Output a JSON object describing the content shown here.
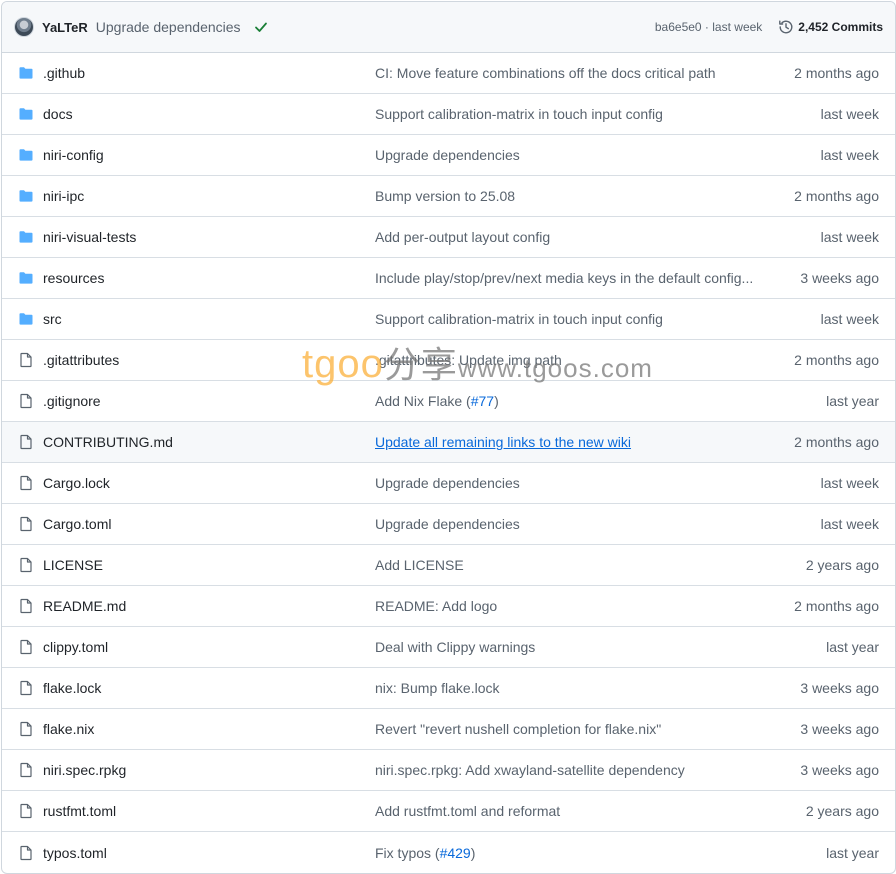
{
  "header": {
    "author": "YaLTeR",
    "commit_message": "Upgrade dependencies",
    "sha": "ba6e5e0",
    "separator": " · ",
    "age": "last week",
    "commits_label": "2,452 Commits"
  },
  "rows": [
    {
      "type": "folder",
      "name": ".github",
      "message": "CI: Move feature combinations off the docs critical path",
      "date": "2 months ago"
    },
    {
      "type": "folder",
      "name": "docs",
      "message": "Support calibration-matrix in touch input config",
      "date": "last week"
    },
    {
      "type": "folder",
      "name": "niri-config",
      "message": "Upgrade dependencies",
      "date": "last week"
    },
    {
      "type": "folder",
      "name": "niri-ipc",
      "message": "Bump version to 25.08",
      "date": "2 months ago"
    },
    {
      "type": "folder",
      "name": "niri-visual-tests",
      "message": "Add per-output layout config",
      "date": "last week"
    },
    {
      "type": "folder",
      "name": "resources",
      "message": "Include play/stop/prev/next media keys in the default config...",
      "date": "3 weeks ago"
    },
    {
      "type": "folder",
      "name": "src",
      "message": "Support calibration-matrix in touch input config",
      "date": "last week"
    },
    {
      "type": "file",
      "name": ".gitattributes",
      "message": ".gitattributes: Update img path",
      "date": "2 months ago"
    },
    {
      "type": "file",
      "name": ".gitignore",
      "message": "Add Nix Flake (",
      "link": "#77",
      "suffix": ")",
      "date": "last year"
    },
    {
      "type": "file",
      "name": "CONTRIBUTING.md",
      "message": "Update all remaining links to the new wiki",
      "date": "2 months ago",
      "hover": true
    },
    {
      "type": "file",
      "name": "Cargo.lock",
      "message": "Upgrade dependencies",
      "date": "last week"
    },
    {
      "type": "file",
      "name": "Cargo.toml",
      "message": "Upgrade dependencies",
      "date": "last week"
    },
    {
      "type": "file",
      "name": "LICENSE",
      "message": "Add LICENSE",
      "date": "2 years ago"
    },
    {
      "type": "file",
      "name": "README.md",
      "message": "README: Add logo",
      "date": "2 months ago"
    },
    {
      "type": "file",
      "name": "clippy.toml",
      "message": "Deal with Clippy warnings",
      "date": "last year"
    },
    {
      "type": "file",
      "name": "flake.lock",
      "message": "nix: Bump flake.lock",
      "date": "3 weeks ago"
    },
    {
      "type": "file",
      "name": "flake.nix",
      "message": "Revert \"revert nushell completion for flake.nix\"",
      "date": "3 weeks ago"
    },
    {
      "type": "file",
      "name": "niri.spec.rpkg",
      "message": "niri.spec.rpkg: Add xwayland-satellite dependency",
      "date": "3 weeks ago"
    },
    {
      "type": "file",
      "name": "rustfmt.toml",
      "message": "Add rustfmt.toml and reformat",
      "date": "2 years ago"
    },
    {
      "type": "file",
      "name": "typos.toml",
      "message": "Fix typos (",
      "link": "#429",
      "suffix": ")",
      "date": "last year"
    }
  ],
  "watermark": {
    "brand": "tgoo",
    "cn": "分享",
    "site": "www.tgoos.com"
  },
  "colors": {
    "folder": "#54aeff",
    "link": "#0969da",
    "muted": "#59636e",
    "success": "#1a7f37"
  },
  "icons": {
    "folder": "folder-icon",
    "file": "file-icon",
    "check": "check-icon",
    "history": "history-icon"
  }
}
